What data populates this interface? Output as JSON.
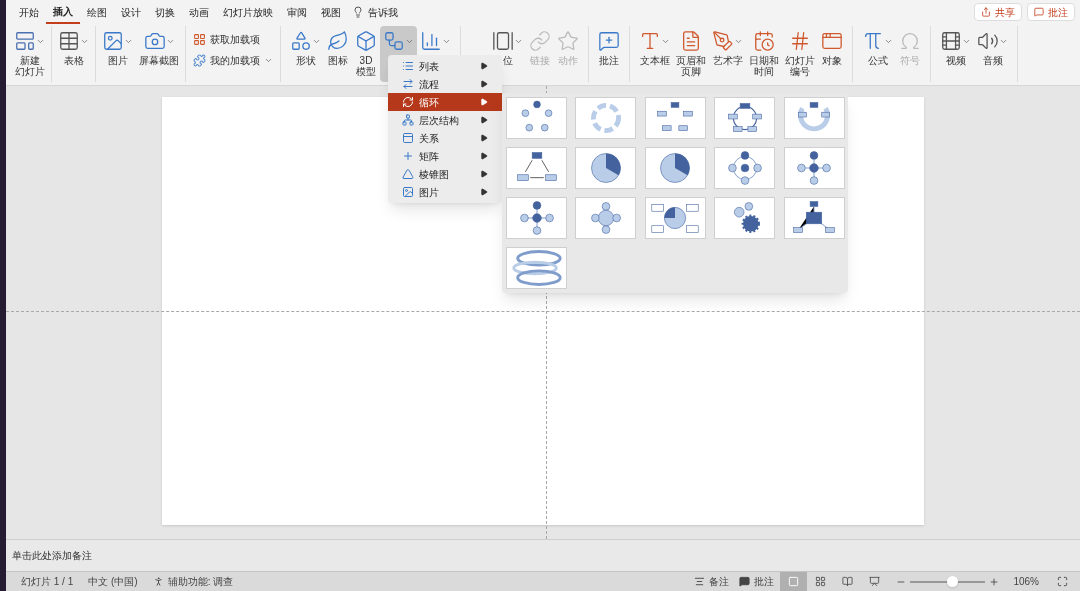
{
  "tabs": [
    {
      "label": "开始",
      "selected": false
    },
    {
      "label": "插入",
      "selected": true
    },
    {
      "label": "绘图",
      "selected": false
    },
    {
      "label": "设计",
      "selected": false
    },
    {
      "label": "切换",
      "selected": false
    },
    {
      "label": "动画",
      "selected": false
    },
    {
      "label": "幻灯片放映",
      "selected": false
    },
    {
      "label": "审阅",
      "selected": false
    },
    {
      "label": "视图",
      "selected": false
    }
  ],
  "tell_me": "告诉我",
  "top_buttons": [
    "共享",
    "批注"
  ],
  "ribbon_groups": [
    [
      {
        "lines": [
          "新建",
          "幻灯片"
        ],
        "dropdown": true,
        "disabled": false
      }
    ],
    [
      {
        "lines": [
          "表格"
        ],
        "dropdown": true,
        "disabled": false
      }
    ],
    [
      {
        "lines": [
          "图片"
        ],
        "dropdown": true,
        "disabled": false
      },
      {
        "lines": [
          "屏幕截图"
        ],
        "dropdown": true,
        "disabled": false
      }
    ],
    [
      {
        "kind": "stack",
        "items": [
          {
            "label": "获取加载项",
            "dropdown": false
          },
          {
            "label": "我的加载项",
            "dropdown": true
          }
        ]
      }
    ],
    [
      {
        "lines": [
          "形状"
        ],
        "dropdown": true,
        "disabled": false
      },
      {
        "lines": [
          "图标"
        ],
        "dropdown": false,
        "disabled": false
      },
      {
        "lines": [
          "3D",
          "模型"
        ],
        "dropdown": false,
        "disabled": false
      },
      {
        "dropdown": true,
        "disabled": false,
        "pressed": true
      },
      {
        "dropdown": true,
        "disabled": false
      }
    ],
    [
      {
        "lines": [
          "位"
        ],
        "dropdown": true,
        "disabled": false
      },
      {
        "lines": [
          "链接"
        ],
        "dropdown": false,
        "disabled": true
      },
      {
        "lines": [
          "动作"
        ],
        "dropdown": false,
        "disabled": true
      }
    ],
    [
      {
        "lines": [
          "批注"
        ],
        "dropdown": false,
        "disabled": false
      }
    ],
    [
      {
        "lines": [
          "文本框"
        ],
        "dropdown": true,
        "disabled": false
      },
      {
        "lines": [
          "页眉和",
          "页脚"
        ],
        "dropdown": false,
        "disabled": false
      },
      {
        "lines": [
          "艺术字"
        ],
        "dropdown": true,
        "disabled": false
      },
      {
        "lines": [
          "日期和",
          "时间"
        ],
        "dropdown": false,
        "disabled": false
      },
      {
        "lines": [
          "幻灯片",
          "编号"
        ],
        "dropdown": false,
        "disabled": false
      },
      {
        "lines": [
          "对象"
        ],
        "dropdown": false,
        "disabled": false
      }
    ],
    [
      {
        "lines": [
          "公式"
        ],
        "dropdown": true,
        "disabled": false
      },
      {
        "lines": [
          "符号"
        ],
        "dropdown": false,
        "disabled": true
      }
    ],
    [
      {
        "lines": [
          "视频"
        ],
        "dropdown": true,
        "disabled": false
      },
      {
        "lines": [
          "音频"
        ],
        "dropdown": true,
        "disabled": false
      }
    ]
  ],
  "smartart_menu": [
    {
      "label": "列表",
      "selected": false
    },
    {
      "label": "流程",
      "selected": false
    },
    {
      "label": "循环",
      "selected": true
    },
    {
      "label": "层次结构",
      "selected": false
    },
    {
      "label": "关系",
      "selected": false
    },
    {
      "label": "矩阵",
      "selected": false
    },
    {
      "label": "棱锥图",
      "selected": false
    },
    {
      "label": "图片",
      "selected": false
    }
  ],
  "gallery": [
    {
      "kind": "circles"
    },
    {
      "kind": "arrows"
    },
    {
      "kind": "boxes"
    },
    {
      "kind": "ring"
    },
    {
      "kind": "segments"
    },
    {
      "kind": "triangle"
    },
    {
      "kind": "pie"
    },
    {
      "kind": "pie"
    },
    {
      "kind": "ring-radial"
    },
    {
      "kind": "radial"
    },
    {
      "kind": "radial"
    },
    {
      "kind": "radial-soft"
    },
    {
      "kind": "quad"
    },
    {
      "kind": "gears"
    },
    {
      "kind": "hub"
    },
    {
      "kind": "spiral"
    }
  ],
  "notes_placeholder": "单击此处添加备注",
  "status_bar": {
    "slide": "幻灯片 1 / 1",
    "language": "中文 (中国)",
    "accessibility": "辅助功能: 调查",
    "notes": "备注",
    "comments": "批注",
    "views": [
      {
        "selected": true
      },
      {
        "selected": false
      },
      {
        "selected": false
      },
      {
        "selected": false
      }
    ],
    "zoom": {
      "level": 0.55
    },
    "zoom_text": "106%"
  }
}
